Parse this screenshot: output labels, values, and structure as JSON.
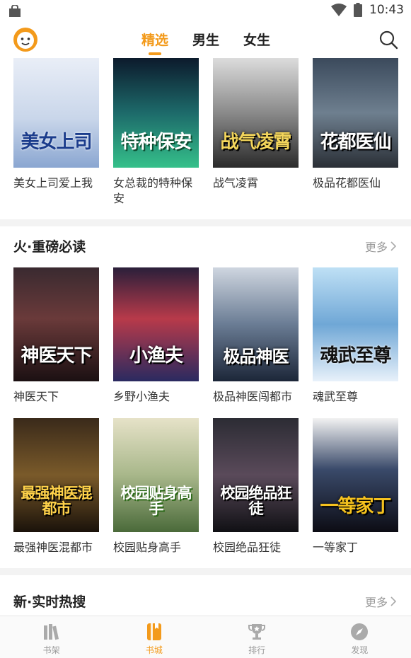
{
  "status_bar": {
    "time": "10:43"
  },
  "top_nav": {
    "tabs": [
      {
        "label": "精选",
        "active": true
      },
      {
        "label": "男生",
        "active": false
      },
      {
        "label": "女生",
        "active": false
      }
    ]
  },
  "colors": {
    "accent": "#f39a1b",
    "muted": "#999999",
    "divider": "#f3f3f3"
  },
  "top_books": [
    {
      "title": "美女上司爱上我",
      "cover_text": "美女上司"
    },
    {
      "title": "女总裁的特种保安",
      "cover_text": "特种保安"
    },
    {
      "title": "战气凌霄",
      "cover_text": "战气凌霄"
    },
    {
      "title": "极品花都医仙",
      "cover_text": "花都医仙"
    }
  ],
  "section_hot": {
    "title": "火·重磅必读",
    "more": "更多",
    "books_row1": [
      {
        "title": "神医天下",
        "cover_text": "神医天下"
      },
      {
        "title": "乡野小渔夫",
        "cover_text": "小渔夫"
      },
      {
        "title": "极品神医闯都市",
        "cover_text": "极品神医"
      },
      {
        "title": "魂武至尊",
        "cover_text": "魂武至尊"
      }
    ],
    "books_row2": [
      {
        "title": "最强神医混都市",
        "cover_text": "最强神医混都市"
      },
      {
        "title": "校园贴身高手",
        "cover_text": "校园贴身高手"
      },
      {
        "title": "校园绝品狂徒",
        "cover_text": "校园绝品狂徒"
      },
      {
        "title": "一等家丁",
        "cover_text": "一等家丁"
      }
    ]
  },
  "section_new": {
    "title": "新·实时热搜",
    "more": "更多"
  },
  "bottom_bar": [
    {
      "label": "书架",
      "icon": "bookshelf-icon",
      "active": false
    },
    {
      "label": "书城",
      "icon": "bookstore-icon",
      "active": true
    },
    {
      "label": "排行",
      "icon": "trophy-icon",
      "active": false
    },
    {
      "label": "发现",
      "icon": "compass-icon",
      "active": false
    }
  ]
}
